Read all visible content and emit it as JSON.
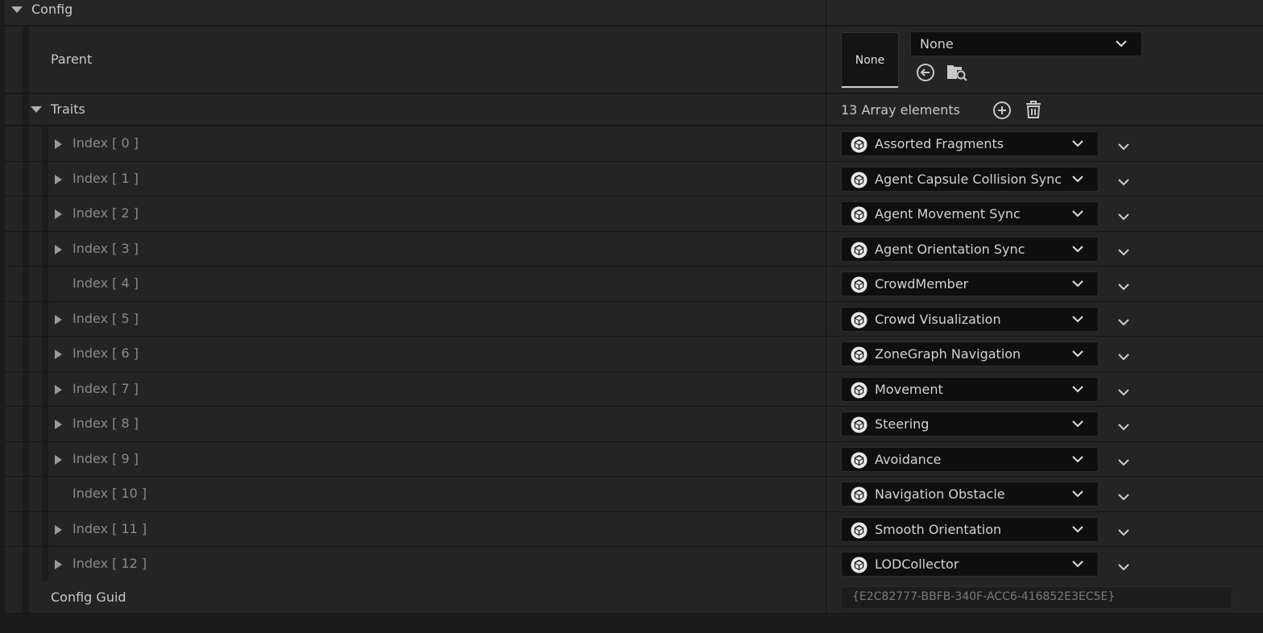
{
  "section": {
    "title": "Config"
  },
  "parent": {
    "label": "Parent",
    "thumbnail_text": "None",
    "combo_value": "None",
    "icons": [
      "back-arrow-icon",
      "browse-folder-icon"
    ]
  },
  "traits": {
    "label": "Traits",
    "count_text": "13 Array elements",
    "icons": [
      "add-element-icon",
      "delete-all-icon"
    ],
    "items": [
      {
        "index": "Index [ 0 ]",
        "value": "Assorted Fragments",
        "expandable": true
      },
      {
        "index": "Index [ 1 ]",
        "value": "Agent Capsule Collision Sync",
        "expandable": true
      },
      {
        "index": "Index [ 2 ]",
        "value": "Agent Movement Sync",
        "expandable": true
      },
      {
        "index": "Index [ 3 ]",
        "value": "Agent Orientation Sync",
        "expandable": true
      },
      {
        "index": "Index [ 4 ]",
        "value": "CrowdMember",
        "expandable": false
      },
      {
        "index": "Index [ 5 ]",
        "value": "Crowd Visualization",
        "expandable": true
      },
      {
        "index": "Index [ 6 ]",
        "value": "ZoneGraph Navigation",
        "expandable": true
      },
      {
        "index": "Index [ 7 ]",
        "value": "Movement",
        "expandable": true
      },
      {
        "index": "Index [ 8 ]",
        "value": "Steering",
        "expandable": true
      },
      {
        "index": "Index [ 9 ]",
        "value": "Avoidance",
        "expandable": true
      },
      {
        "index": "Index [ 10 ]",
        "value": "Navigation Obstacle",
        "expandable": false
      },
      {
        "index": "Index [ 11 ]",
        "value": "Smooth Orientation",
        "expandable": true
      },
      {
        "index": "Index [ 12 ]",
        "value": "LODCollector",
        "expandable": true
      }
    ]
  },
  "config_guid": {
    "label": "Config Guid",
    "value": "{E2C82777-BBFB-340F-ACC6-416852E3EC5E}"
  },
  "colors": {
    "background": "#242424",
    "combo_bg": "#0f0f0f",
    "text": "#c8c8c8",
    "dim_text": "#8a8a8a"
  }
}
